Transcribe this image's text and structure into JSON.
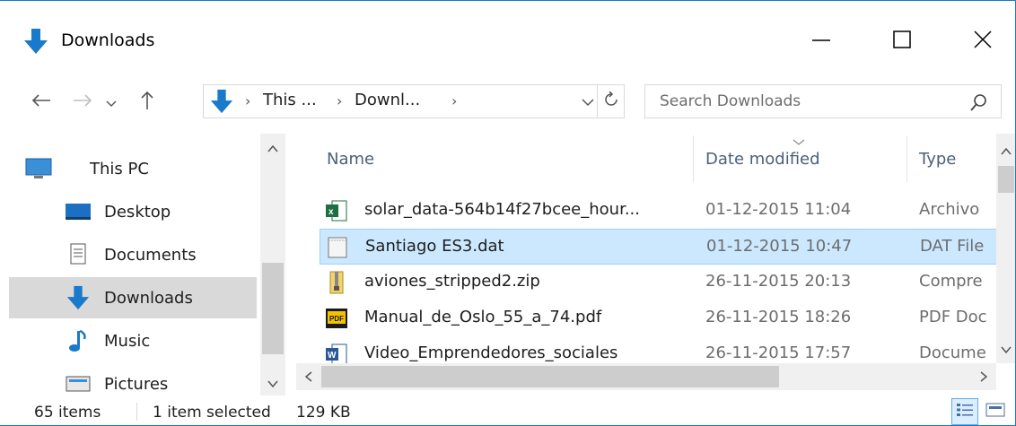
{
  "window": {
    "title": "Downloads",
    "icon": "download-arrow-icon",
    "controls": {
      "minimize": "minimize-icon",
      "maximize": "maximize-icon",
      "close": "close-icon"
    }
  },
  "address_bar": {
    "crumbs": [
      "This ...",
      "Downl..."
    ],
    "icons": {
      "back": "arrow-left-icon",
      "forward": "arrow-right-icon",
      "recent": "chevron-down-icon",
      "up": "arrow-up-icon",
      "refresh": "refresh-icon"
    }
  },
  "search": {
    "placeholder": "Search Downloads"
  },
  "nav_pane": {
    "items": [
      {
        "label": "This PC",
        "icon": "computer-icon"
      },
      {
        "label": "Desktop",
        "icon": "desktop-icon"
      },
      {
        "label": "Documents",
        "icon": "documents-icon"
      },
      {
        "label": "Downloads",
        "icon": "download-arrow-icon",
        "selected": true
      },
      {
        "label": "Music",
        "icon": "music-note-icon"
      },
      {
        "label": "Pictures",
        "icon": "pictures-icon"
      }
    ]
  },
  "file_list": {
    "columns": {
      "name": "Name",
      "date": "Date modified",
      "type": "Type"
    },
    "rows": [
      {
        "name": "solar_data-564b14f27bcee_hour...",
        "date": "01-12-2015 11:04",
        "type": "Archivo",
        "icon": "excel-file-icon"
      },
      {
        "name": "Santiago ES3.dat",
        "date": "01-12-2015 10:47",
        "type": "DAT File",
        "icon": "dat-file-icon",
        "selected": true
      },
      {
        "name": "aviones_stripped2.zip",
        "date": "26-11-2015 20:13",
        "type": "Compre",
        "icon": "zip-file-icon"
      },
      {
        "name": "Manual_de_Oslo_55_a_74.pdf",
        "date": "26-11-2015 18:26",
        "type": "PDF Doc",
        "icon": "pdf-file-icon"
      },
      {
        "name": "Video_Emprendedores_sociales",
        "date": "26-11-2015 17:57",
        "type": "Docume",
        "icon": "word-file-icon"
      }
    ]
  },
  "status_bar": {
    "item_count": "65 items",
    "selection": "1 item selected",
    "size": "129 KB"
  },
  "colors": {
    "accent": "#1979ca",
    "selection": "#cce8ff",
    "nav_selected": "#d9d9d9",
    "header_text": "#4c607a"
  }
}
